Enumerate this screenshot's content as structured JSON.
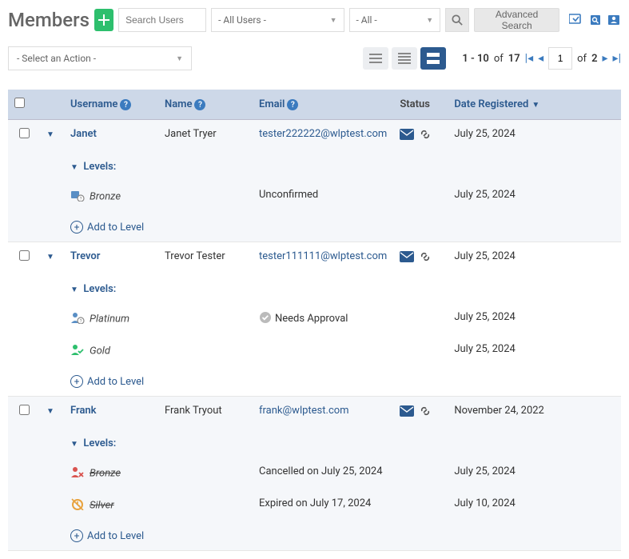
{
  "header": {
    "title": "Members",
    "search_placeholder": "Search Users",
    "dd_users": "- All Users -",
    "dd_all": "- All -",
    "advanced": "Advanced Search"
  },
  "toolbar": {
    "action_placeholder": "- Select an Action -",
    "range": "1 - 10",
    "of_label": "of",
    "total": "17",
    "page": "1",
    "of_pages_label": "of",
    "pages": "2"
  },
  "columns": {
    "username": "Username",
    "name": "Name",
    "email": "Email",
    "status": "Status",
    "date": "Date Registered"
  },
  "rows": [
    {
      "username": "Janet",
      "name": "Janet Tryer",
      "email": "tester222222@wlptest.com",
      "date": "July 25, 2024",
      "alt": true,
      "levels_label": "Levels:",
      "levels": [
        {
          "name": "Bronze",
          "status": "Unconfirmed",
          "date": "July 25, 2024",
          "icon": "bronze-pending",
          "strike": false
        }
      ],
      "add_level": "Add to Level"
    },
    {
      "username": "Trevor",
      "name": "Trevor Tester",
      "email": "tester111111@wlptest.com",
      "date": "July 25, 2024",
      "alt": false,
      "levels_label": "Levels:",
      "levels": [
        {
          "name": "Platinum",
          "status": "Needs Approval",
          "status_icon": "check-circle",
          "date": "July 25, 2024",
          "icon": "platinum-pending",
          "strike": false
        },
        {
          "name": "Gold",
          "status": "",
          "date": "July 25, 2024",
          "icon": "gold-active",
          "strike": false
        }
      ],
      "add_level": "Add to Level"
    },
    {
      "username": "Frank",
      "name": "Frank Tryout",
      "email": "frank@wlptest.com",
      "date": "November 24, 2022",
      "alt": true,
      "levels_label": "Levels:",
      "levels": [
        {
          "name": "Bronze",
          "status": "Cancelled on July 25, 2024",
          "date": "July 25, 2024",
          "icon": "cancelled",
          "strike": true
        },
        {
          "name": "Silver",
          "status": "Expired on July 17, 2024",
          "date": "July 10, 2024",
          "icon": "expired",
          "strike": true
        }
      ],
      "add_level": "Add to Level"
    }
  ]
}
